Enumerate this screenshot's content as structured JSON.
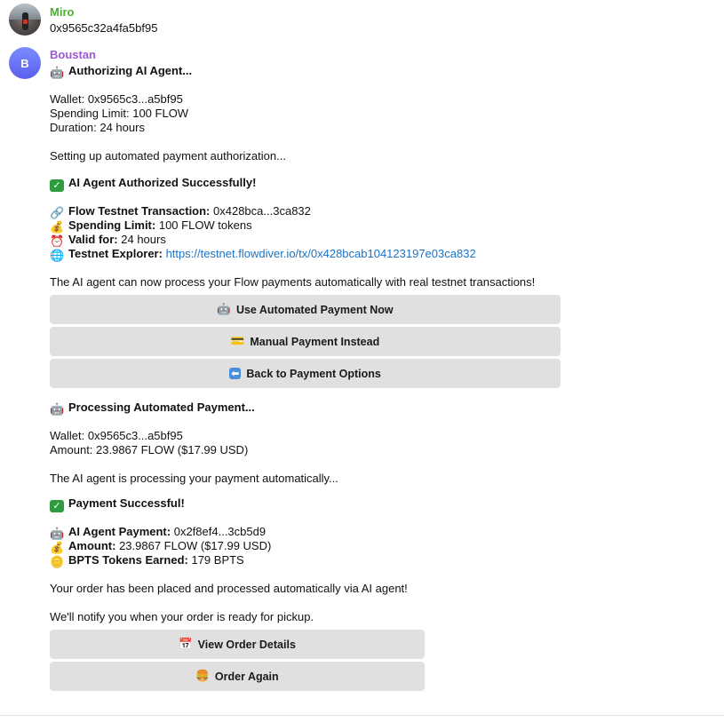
{
  "messages": {
    "m1": {
      "sender": "Miro",
      "text": "0x9565c32a4fa5bf95"
    },
    "m2": {
      "sender": "Boustan",
      "avatar_letter": "B",
      "auth_title": "Authorizing AI Agent...",
      "wallet": "Wallet: 0x9565c3...a5bf95",
      "limit": "Spending Limit: 100 FLOW",
      "duration": "Duration: 24 hours",
      "setup": "Setting up automated payment authorization...",
      "auth_success": "AI Agent Authorized Successfully!",
      "tx_label": "Flow Testnet Transaction:",
      "tx_value": "0x428bca...3ca832",
      "spend_label": "Spending Limit:",
      "spend_value": "100 FLOW tokens",
      "valid_label": "Valid for:",
      "valid_value": "24 hours",
      "explorer_label": "Testnet Explorer:",
      "explorer_link": "https://testnet.flowdiver.io/tx/0x428bcab104123197e03ca832",
      "agent_note": "The AI agent can now process your Flow payments automatically with real testnet transactions!",
      "btn_auto": "Use Automated Payment Now",
      "btn_manual": "Manual Payment Instead",
      "btn_back": "Back to Payment Options",
      "proc_title": "Processing Automated Payment...",
      "proc_wallet": "Wallet: 0x9565c3...a5bf95",
      "proc_amount": "Amount: 23.9867 FLOW ($17.99 USD)",
      "proc_note": "The AI agent is processing your payment automatically...",
      "pay_success": "Payment Successful!",
      "agent_pay_label": "AI Agent Payment:",
      "agent_pay_value": "0x2f8ef4...3cb5d9",
      "amount_label": "Amount:",
      "amount_value": "23.9867 FLOW ($17.99 USD)",
      "bpts_label": "BPTS Tokens Earned:",
      "bpts_value": "179 BPTS",
      "placed_note": "Your order has been placed and processed automatically via AI agent!",
      "notify_note": "We'll notify you when your order is ready for pickup.",
      "btn_details": "View Order Details",
      "btn_again": "Order Again"
    }
  },
  "icons": {
    "robot": "🤖",
    "check": "✓",
    "link": "🔗",
    "money": "💰",
    "clock": "⏰",
    "globe": "🌐",
    "card": "💳",
    "back": "⬅",
    "bpts": "🪙",
    "calendar": "📅",
    "burger": "🍔"
  },
  "colors": {
    "sender1": "#4caf2f",
    "sender2": "#9b59d6",
    "link": "#1a73c8",
    "button_bg": "#e0e0e0"
  }
}
